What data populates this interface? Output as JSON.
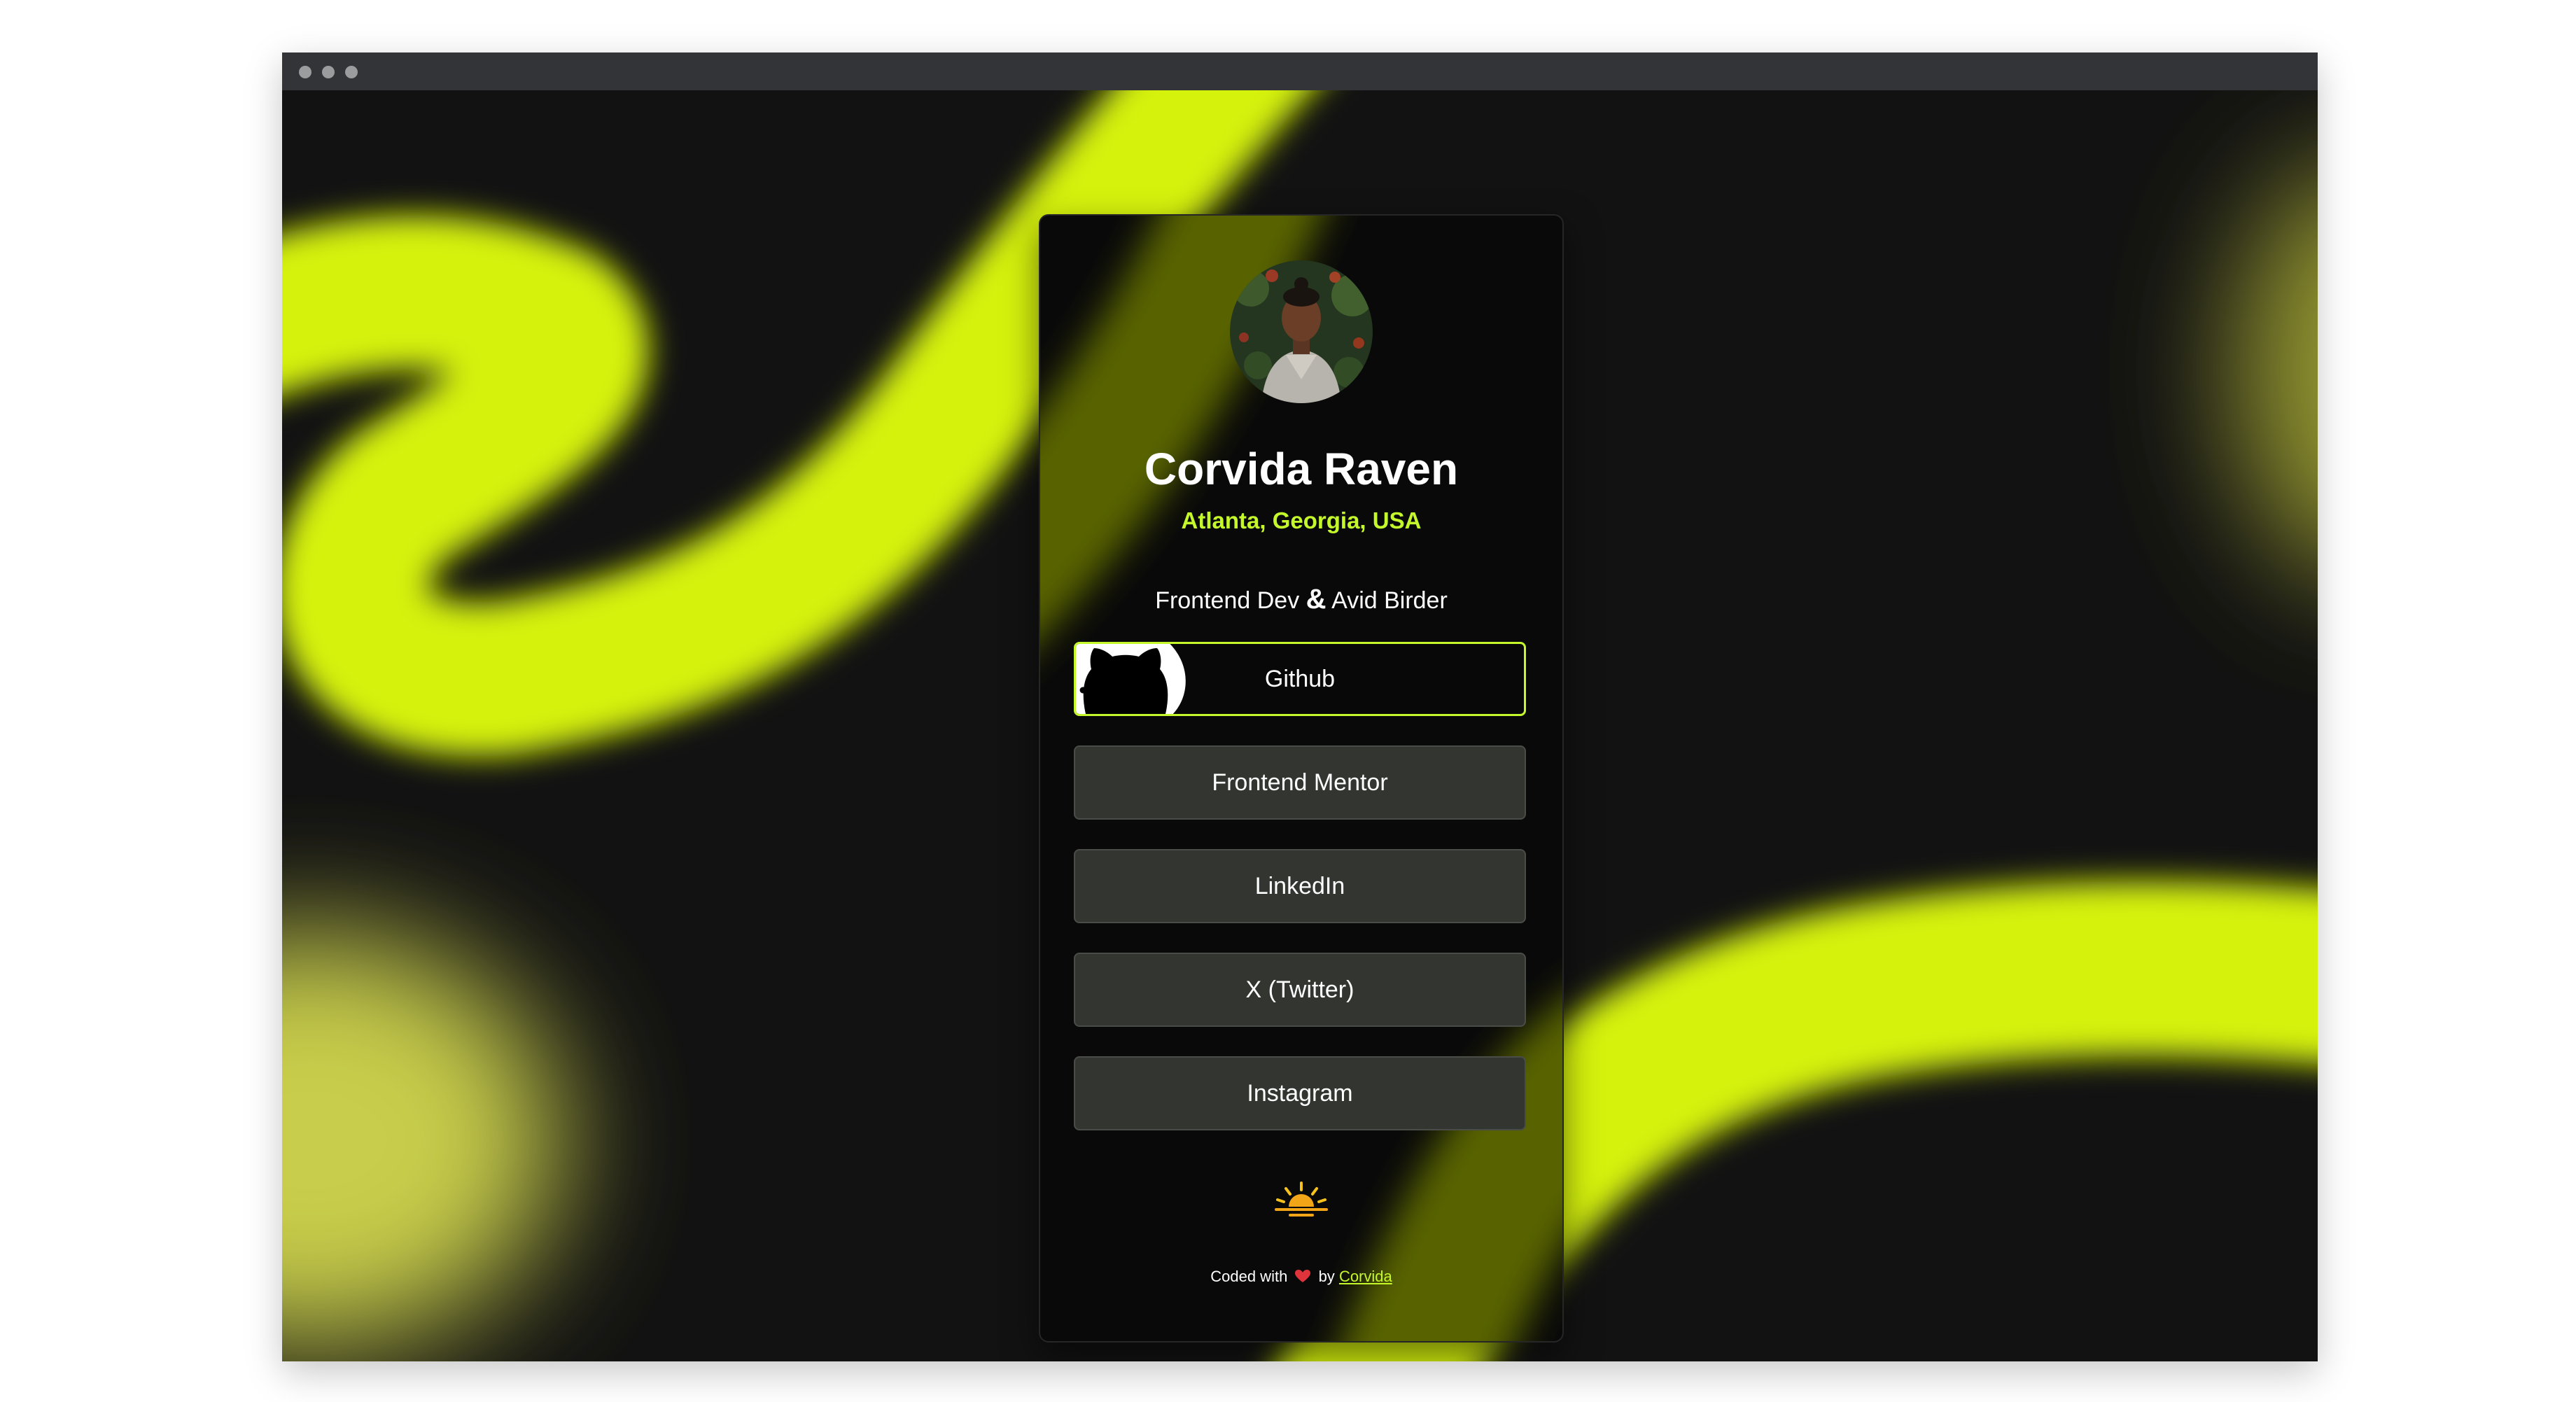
{
  "profile": {
    "name": "Corvida Raven",
    "location": "Atlanta, Georgia, USA",
    "bio_part1": "Frontend Dev",
    "bio_amp": "&",
    "bio_part2": "Avid Birder"
  },
  "links": [
    {
      "label": "Github",
      "icon": "github-icon",
      "active": true
    },
    {
      "label": "Frontend Mentor"
    },
    {
      "label": "LinkedIn"
    },
    {
      "label": "X (Twitter)"
    },
    {
      "label": "Instagram"
    }
  ],
  "footer": {
    "prefix": "Coded with",
    "by": "by",
    "author": "Corvida",
    "icon": "heart-icon"
  },
  "decor": {
    "theme_icon": "sunrise-icon"
  },
  "colors": {
    "accent": "#c4f82a",
    "background": "#121212",
    "card": "#090909",
    "button": "#333530"
  }
}
